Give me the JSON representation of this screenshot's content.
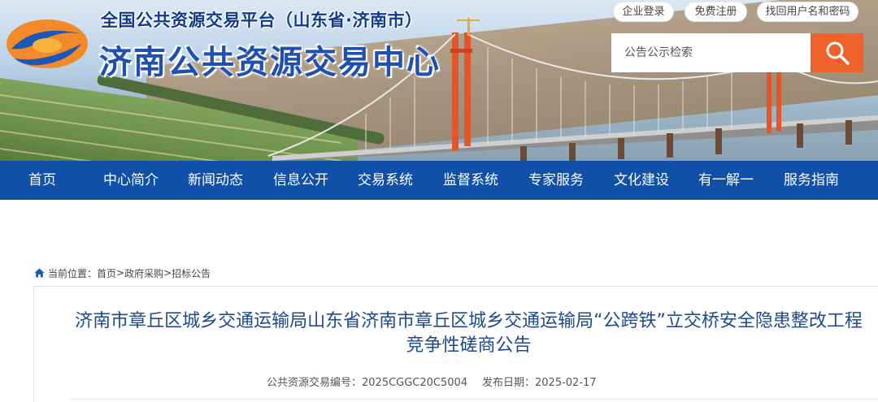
{
  "header": {
    "subtitle": "全国公共资源交易平台（山东省·济南市）",
    "title": "济南公共资源交易中心",
    "top_links": {
      "login": "企业登录",
      "register": "免费注册",
      "find_account": "找回用户名和密码"
    },
    "search": {
      "placeholder": "公告公示检索",
      "icon": "search-icon"
    }
  },
  "nav": {
    "items": [
      "首页",
      "中心简介",
      "新闻动态",
      "信息公开",
      "交易系统",
      "监督系统",
      "专家服务",
      "文化建设",
      "有一解一",
      "服务指南"
    ]
  },
  "breadcrumb": {
    "label": "当前位置：",
    "items": [
      "首页",
      "政府采购",
      "招标公告"
    ],
    "separator": ">"
  },
  "article": {
    "title": "济南市章丘区城乡交通运输局山东省济南市章丘区城乡交通运输局“公跨铁”立交桥安全隐患整改工程竞争性磋商公告",
    "code_label": "公共资源交易编号：2025CGGC20C5004",
    "date_label": "发布日期：2025-02-17"
  },
  "colors": {
    "nav_bg": "#1150a8",
    "search_button": "#f0622c",
    "title_blue": "#1d4a8f",
    "header_title": "#1f4fb0"
  }
}
